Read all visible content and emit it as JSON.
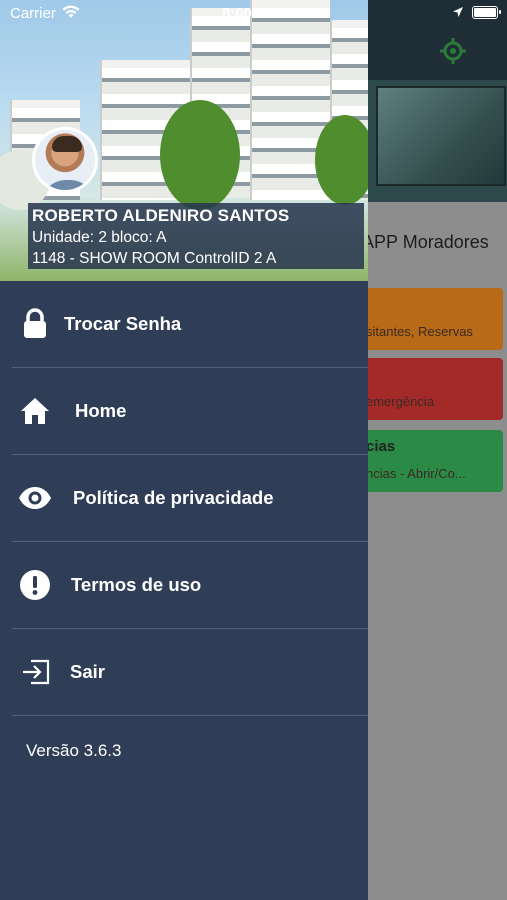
{
  "status_bar": {
    "carrier": "Carrier",
    "time": "8:00 PM"
  },
  "background_app": {
    "title": "APP Moradores",
    "cards": [
      {
        "title": "",
        "subtitle": "sitantes, Reservas",
        "color": "#b96a17"
      },
      {
        "title": "",
        "subtitle": "emergência",
        "color": "#a42a2a"
      },
      {
        "title": "cias",
        "subtitle": "ncias - Abrir/Co...",
        "color": "#2b8a46"
      }
    ]
  },
  "user": {
    "name": "ROBERTO ALDENIRO SANTOS",
    "unit": "Unidade: 2 bloco: A",
    "condo": "1148 - SHOW ROOM ControlID 2 A"
  },
  "menu": [
    {
      "label": "Trocar Senha",
      "icon": "lock-icon"
    },
    {
      "label": "Home",
      "icon": "home-icon"
    },
    {
      "label": "Política de privacidade",
      "icon": "eye-icon"
    },
    {
      "label": "Termos de uso",
      "icon": "exclamation-circle-icon"
    },
    {
      "label": "Sair",
      "icon": "sign-out-icon"
    }
  ],
  "version": "Versão 3.6.3",
  "colors": {
    "drawer": "#2f3d57",
    "topbar": "#1f2d36",
    "accent_green": "#2b8a46"
  }
}
